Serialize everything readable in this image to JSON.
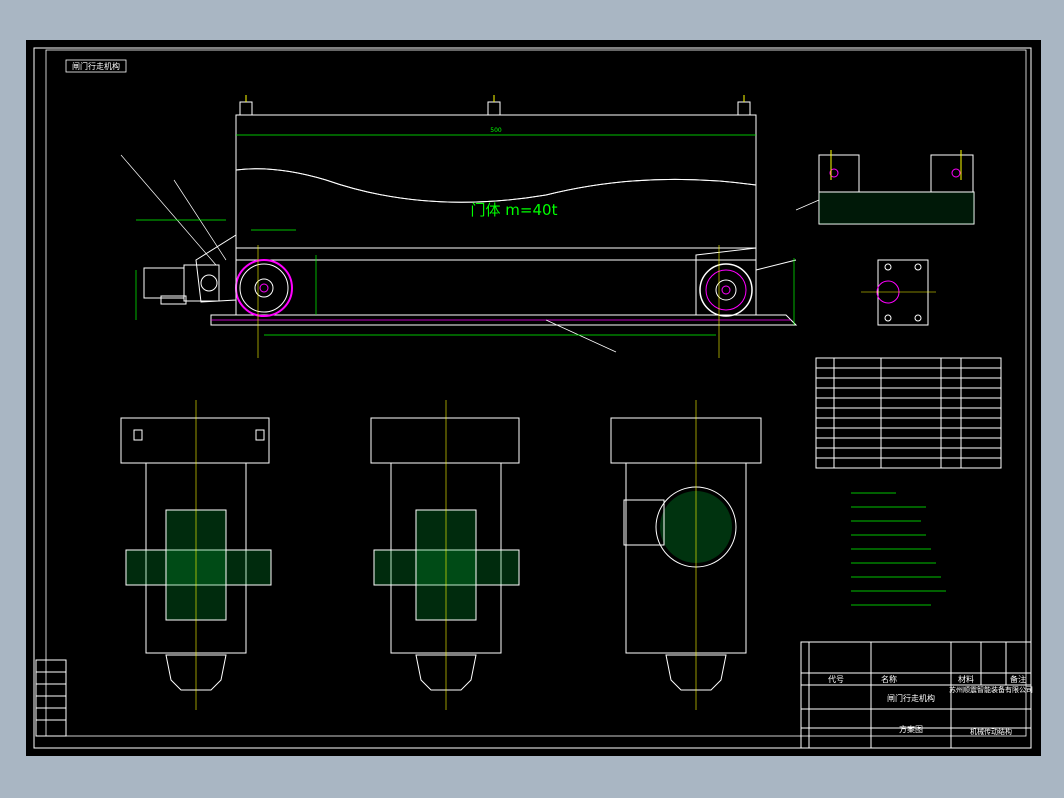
{
  "drawing": {
    "sheet_label": "闸门行走机构",
    "main_text": "门体  m=40t",
    "title_block": {
      "project_name": "闸门行走机构",
      "drawing_type": "方案图",
      "company": "苏州顺震智能装备有限公司",
      "part_title": "机械传动结构",
      "header_code": "代号",
      "header_name": "名称",
      "header_material": "材料",
      "header_note": "备注"
    }
  }
}
